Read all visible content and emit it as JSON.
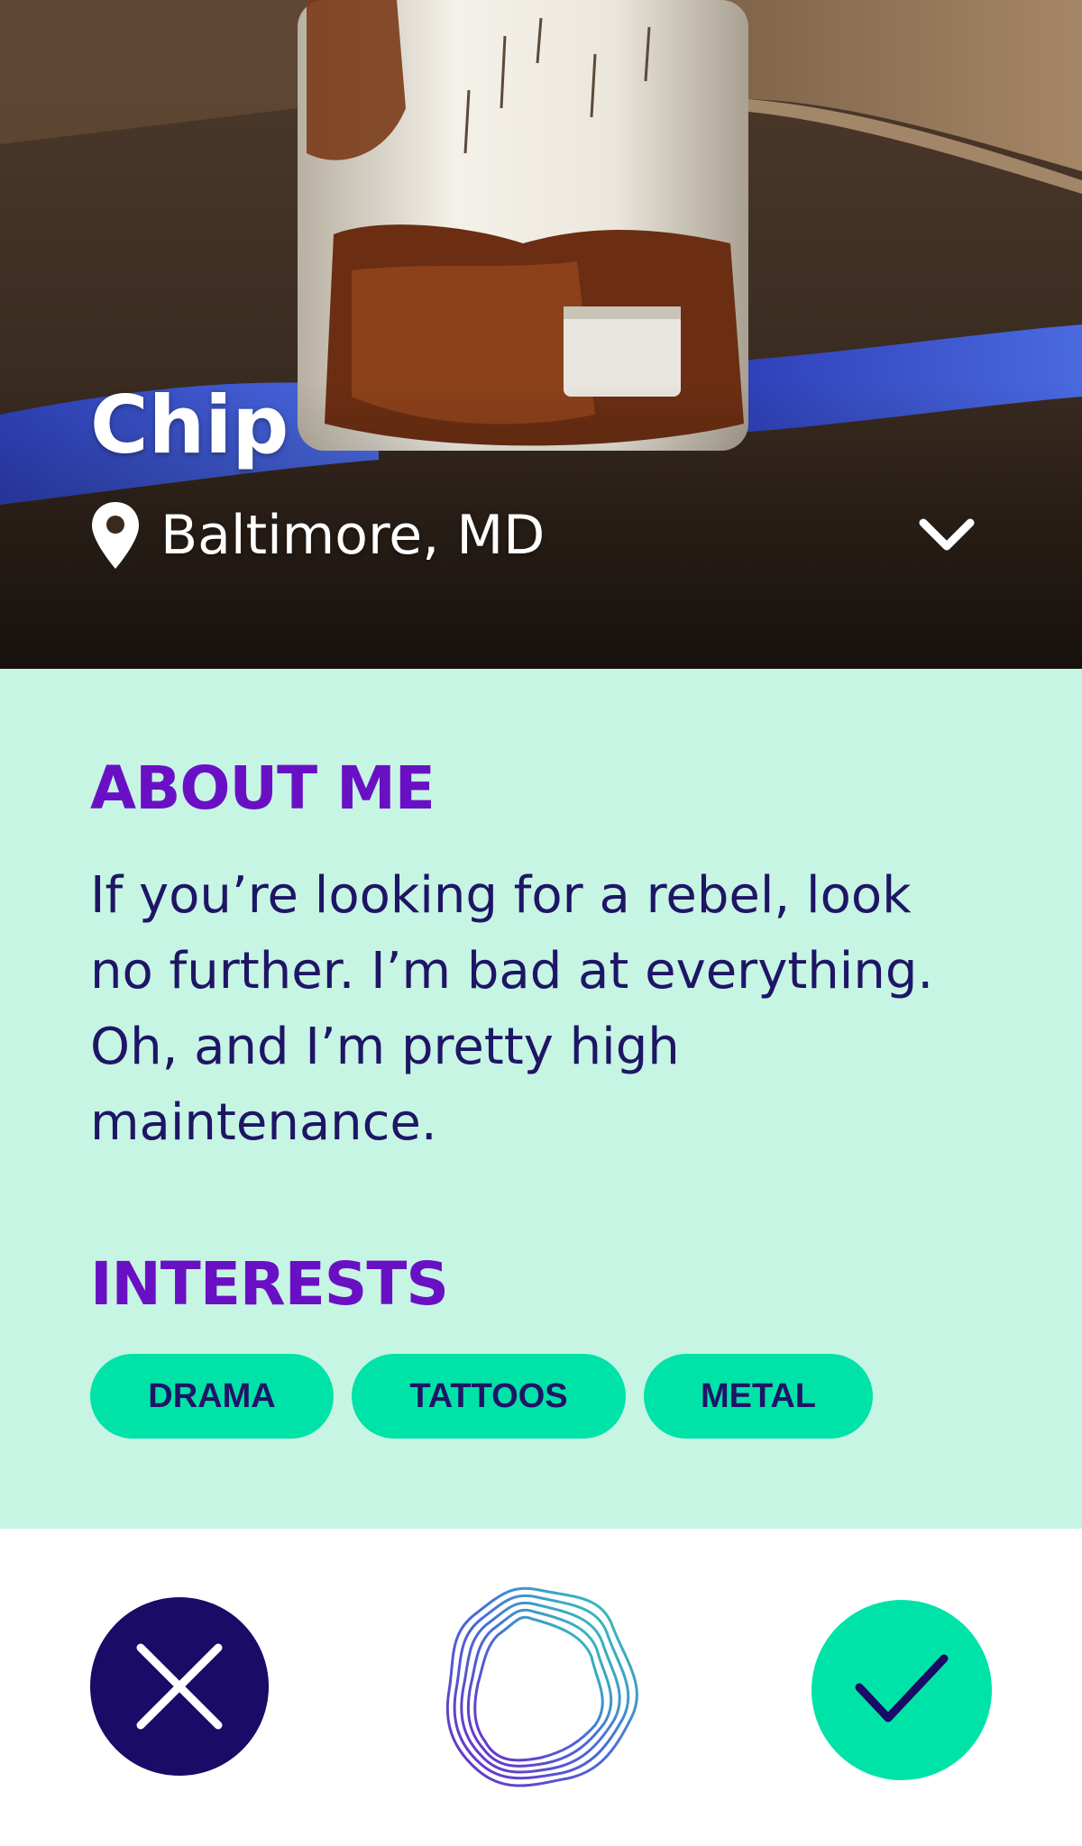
{
  "profile": {
    "name": "Chip",
    "location": "Baltimore, MD"
  },
  "about": {
    "heading": "ABOUT ME",
    "text": "If you’re looking for a rebel, look no further. I’m bad at everything. Oh, and I’m pretty high maintenance."
  },
  "interests": {
    "heading": "INTERESTS",
    "tags": [
      "DRAMA",
      "TATTOOS",
      "METAL"
    ]
  },
  "icons": {
    "location": "map-pin-icon",
    "expand": "chevron-down-icon",
    "reject": "close-icon",
    "center": "swirl-logo-icon",
    "accept": "check-icon"
  },
  "colors": {
    "heading": "#6a10c4",
    "body_text": "#1f1566",
    "panel_bg": "#c6f5e3",
    "accent": "#00e3a8",
    "reject_bg": "#190b66"
  }
}
